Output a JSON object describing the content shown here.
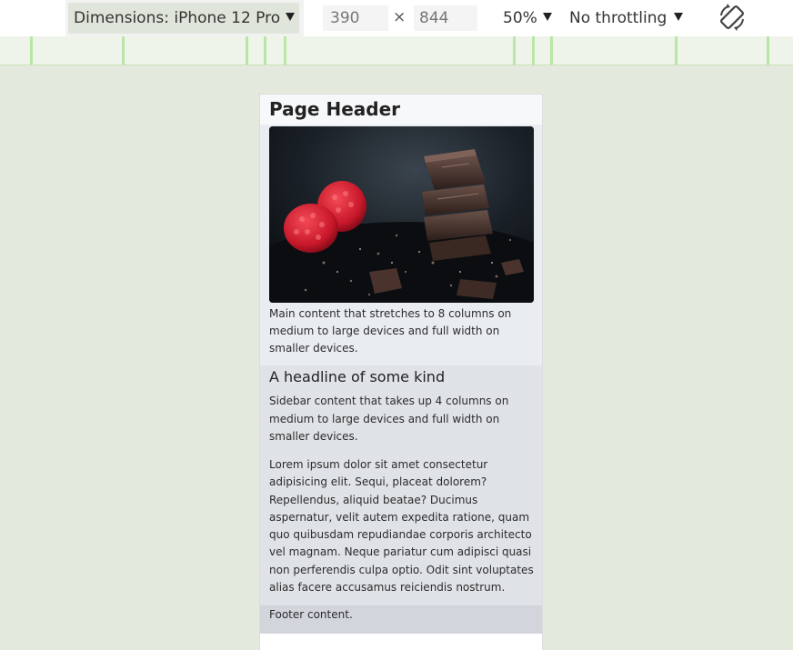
{
  "toolbar": {
    "dimensions_label": "Dimensions: iPhone 12 Pro",
    "width_value": "390",
    "times": "×",
    "height_value": "844",
    "zoom_label": "50%",
    "throttling_label": "No throttling",
    "rotate_icon": "rotate-device-icon"
  },
  "page": {
    "header": "Page Header",
    "image_icon": "chocolate-raspberry-photo",
    "main_text": "Main content that stretches to 8 columns on medium to large devices and full width on smaller devices.",
    "sidebar_title": "A headline of some kind",
    "sidebar_text": "Sidebar content that takes up 4 columns on medium to large devices and full width on smaller devices.",
    "sidebar_lorem": "Lorem ipsum dolor sit amet consectetur adipisicing elit. Sequi, placeat dolorem? Repellendus, aliquid beatae? Ducimus aspernatur, velit autem expedita ratione, quam quo quibusdam repudiandae corporis architecto vel magnam. Neque pariatur cum adipisci quasi non perferendis culpa optio. Odit sint voluptates alias facere accusamus reiciendis nostrum.",
    "footer": "Footer content."
  },
  "colors": {
    "viewport_background": "#e4e9dd",
    "ruler_tick": "#b9e6a6",
    "header_bg": "#f7f8fa",
    "main_bg": "#e9edf1",
    "sidebar_bg": "#dfe2e6",
    "footer_bg": "#d2d6dc"
  }
}
